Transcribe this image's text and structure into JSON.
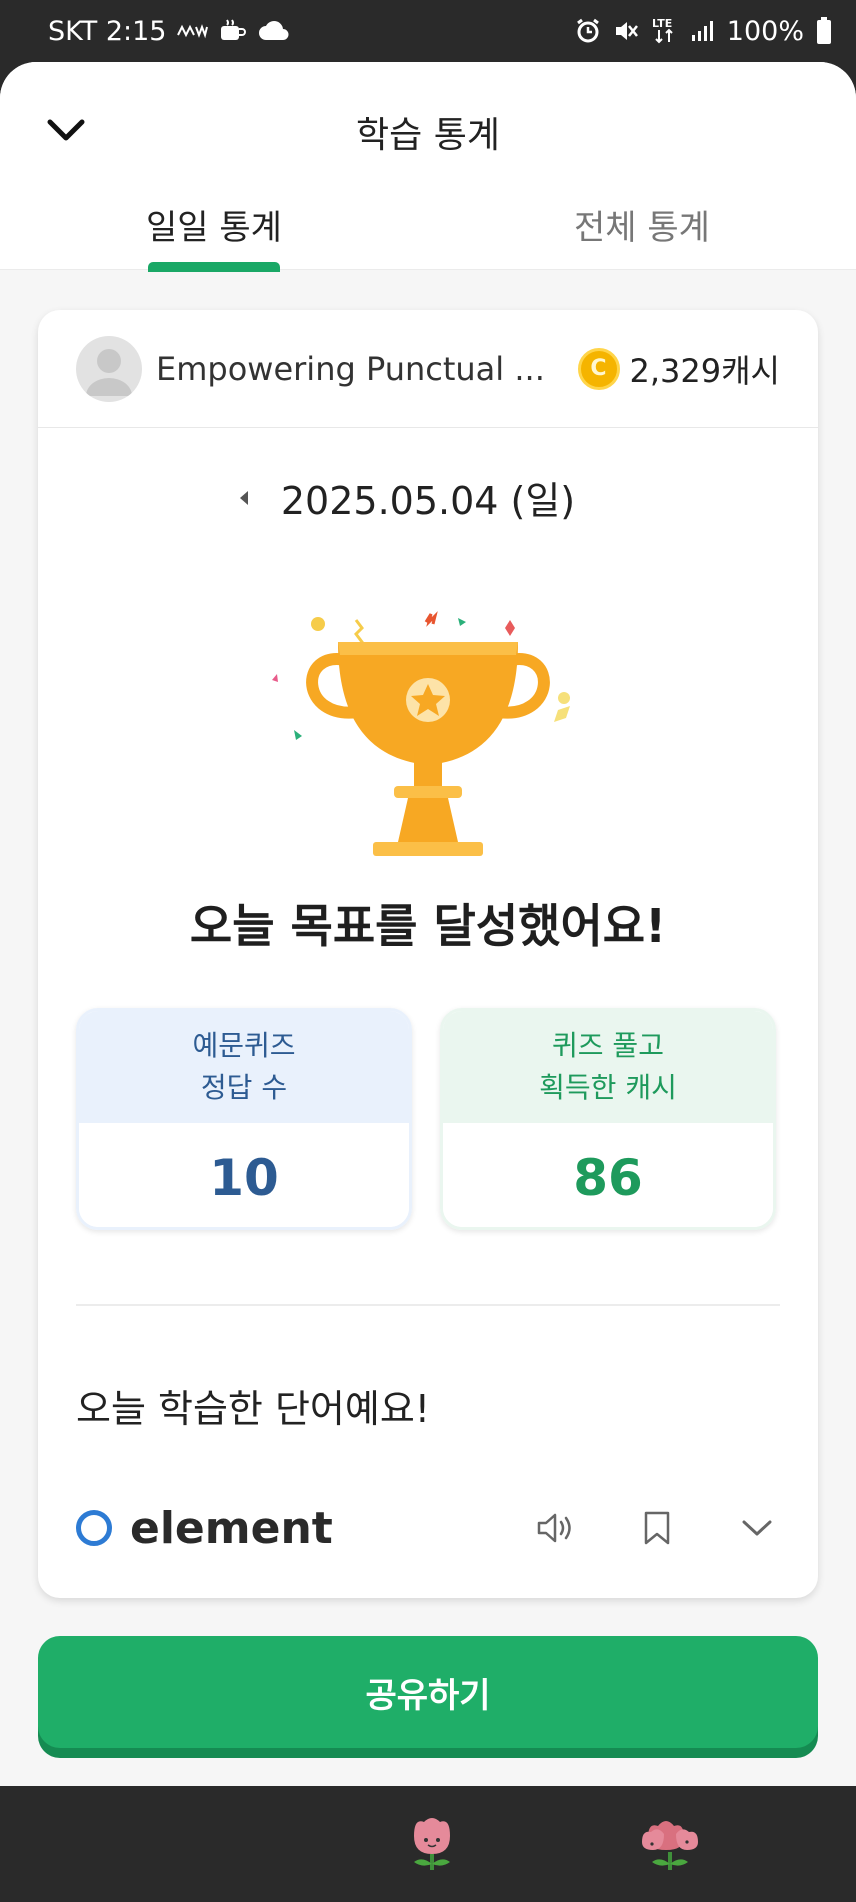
{
  "status_bar": {
    "carrier_time": "SKT 2:15",
    "left_icons": [
      "mw-icon",
      "coffee-icon",
      "cloud-icon"
    ],
    "battery": "100%",
    "right_icons": [
      "alarm-icon",
      "mute-icon",
      "lte-icon",
      "signal-icon",
      "battery-icon"
    ]
  },
  "header": {
    "title": "학습 통계",
    "tabs": [
      {
        "label": "일일 통계",
        "active": true
      },
      {
        "label": "전체 통계",
        "active": false
      }
    ]
  },
  "profile": {
    "name": "Empowering Punctual ...",
    "cash": "2,329캐시",
    "coin_symbol": "C"
  },
  "date": {
    "value": "2025.05.04 (일)"
  },
  "achievement": "오늘 목표를 달성했어요!",
  "stats": [
    {
      "label_line1": "예문퀴즈",
      "label_line2": "정답 수",
      "value": "10"
    },
    {
      "label_line1": "퀴즈 풀고",
      "label_line2": "획득한 캐시",
      "value": "86"
    }
  ],
  "words": {
    "heading": "오늘 학습한 단어예요!",
    "items": [
      {
        "word": "element"
      }
    ]
  },
  "share_button": "공유하기",
  "colors": {
    "accent_green": "#1fae68",
    "stat_blue": "#2d5b92",
    "stat_green": "#1e9a5c",
    "trophy": "#f7a823"
  }
}
